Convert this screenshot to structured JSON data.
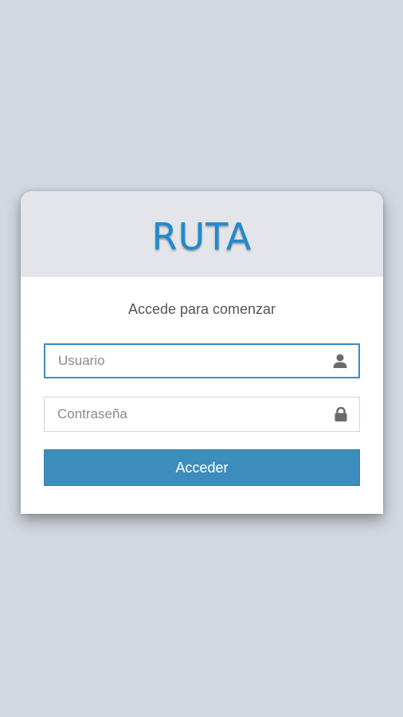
{
  "brand": {
    "title": "RUTA",
    "color": "#1f8ad0"
  },
  "login": {
    "subtitle": "Accede para comenzar",
    "username": {
      "placeholder": "Usuario",
      "value": "",
      "icon": "user-icon"
    },
    "password": {
      "placeholder": "Contraseña",
      "value": "",
      "icon": "lock-icon"
    },
    "submit_label": "Acceder",
    "accent_color": "#3c8dbc"
  }
}
